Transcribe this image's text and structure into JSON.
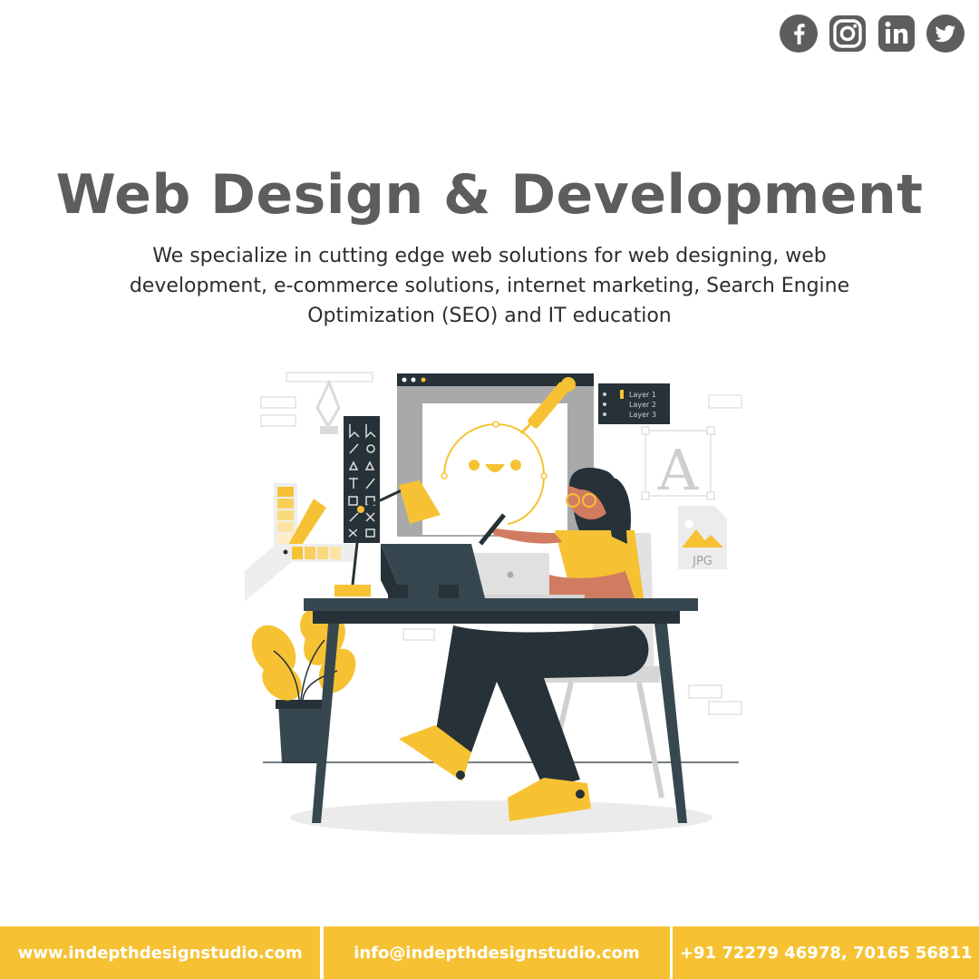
{
  "social": {
    "icons": [
      "facebook-icon",
      "instagram-icon",
      "linkedin-icon",
      "twitter-icon"
    ],
    "color": "#5c5d5f"
  },
  "hero": {
    "title": "Web Design & Development",
    "description": "We specialize in cutting edge web solutions for web designing, web development, e-commerce solutions, internet marketing, Search Engine Optimization (SEO) and IT education"
  },
  "illustration": {
    "layers": [
      "Layer 1",
      "Layer 2",
      "Layer 3"
    ],
    "letter": "A",
    "file_label": "JPG"
  },
  "footer": {
    "website": "www.indepthdesignstudio.com",
    "email": "info@indepthdesignstudio.com",
    "phone": "+91 72279 46978, 70165 56811"
  },
  "colors": {
    "accent": "#f6c234",
    "heading": "#5c5d5f",
    "dark": "#263238"
  }
}
